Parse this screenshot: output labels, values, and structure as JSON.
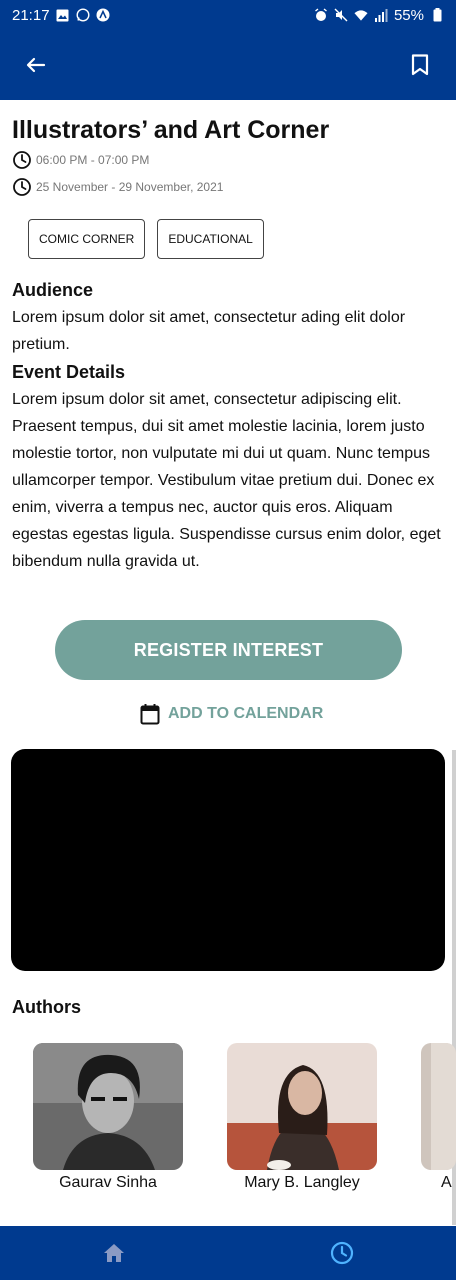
{
  "status_bar": {
    "time": "21:17",
    "battery": "55%"
  },
  "header": {
    "back_icon": "arrow-left-icon",
    "bookmark_icon": "bookmark-icon"
  },
  "event": {
    "title": "Illustrators’ and Art Corner",
    "time": "06:00 PM - 07:00 PM",
    "dates": "25 November - 29 November, 2021",
    "tags": [
      "COMIC CORNER",
      "EDUCATIONAL"
    ],
    "audience_heading": "Audience",
    "audience_text": "Lorem ipsum dolor sit amet, consectetur ading elit dolor pretium.",
    "details_heading": "Event Details",
    "details_text": "Lorem ipsum dolor sit amet, consectetur adipiscing elit. Praesent tempus, dui sit amet molestie lacinia, lorem justo molestie tortor, non vulputate mi dui ut quam. Nunc tempus ullamcorper tempor. Vestibulum vitae pretium dui. Donec ex enim, viverra a tempus nec, auctor quis eros. Aliquam egestas egestas ligula. Suspendisse cursus enim dolor, eget bibendum nulla gravida ut."
  },
  "actions": {
    "register_label": "REGISTER INTEREST",
    "calendar_label": "ADD TO CALENDAR"
  },
  "authors": {
    "heading": "Authors",
    "items": [
      {
        "name": "Gaurav Sinha"
      },
      {
        "name": "Mary B. Langley"
      },
      {
        "name": "A"
      }
    ]
  },
  "bottom_nav": {
    "items": [
      "home-icon",
      "clock-icon"
    ]
  },
  "colors": {
    "primary": "#003a8f",
    "accent": "#73a29b",
    "nav_active": "#4fb3ff"
  }
}
